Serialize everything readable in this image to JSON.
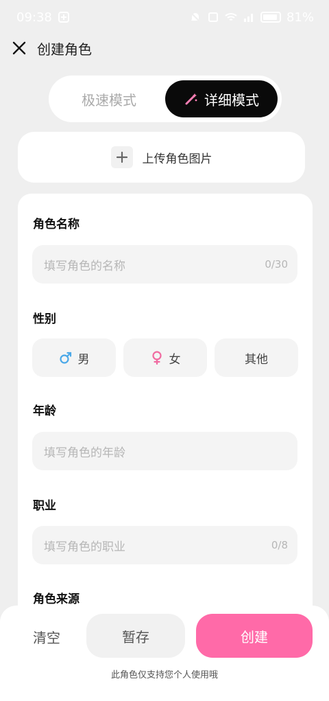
{
  "status_bar": {
    "time": "09:38",
    "battery": "81%"
  },
  "header": {
    "title": "创建角色"
  },
  "mode_switch": {
    "fast_label": "极速模式",
    "detailed_label": "详细模式"
  },
  "upload": {
    "label": "上传角色图片"
  },
  "form": {
    "name": {
      "label": "角色名称",
      "placeholder": "填写角色的名称",
      "counter": "0/30"
    },
    "gender": {
      "label": "性别",
      "options": [
        "男",
        "女",
        "其他"
      ]
    },
    "age": {
      "label": "年龄",
      "placeholder": "填写角色的年龄"
    },
    "job": {
      "label": "职业",
      "placeholder": "填写角色的职业",
      "counter": "0/8"
    },
    "source": {
      "label": "角色来源"
    }
  },
  "bottom": {
    "clear_label": "清空",
    "save_label": "暂存",
    "create_label": "创建",
    "notice": "此角色仅支持您个人使用哦"
  },
  "colors": {
    "accent_pink": "#ff6aa8",
    "male_blue": "#4aa8e8",
    "female_pink": "#f06aa0"
  }
}
